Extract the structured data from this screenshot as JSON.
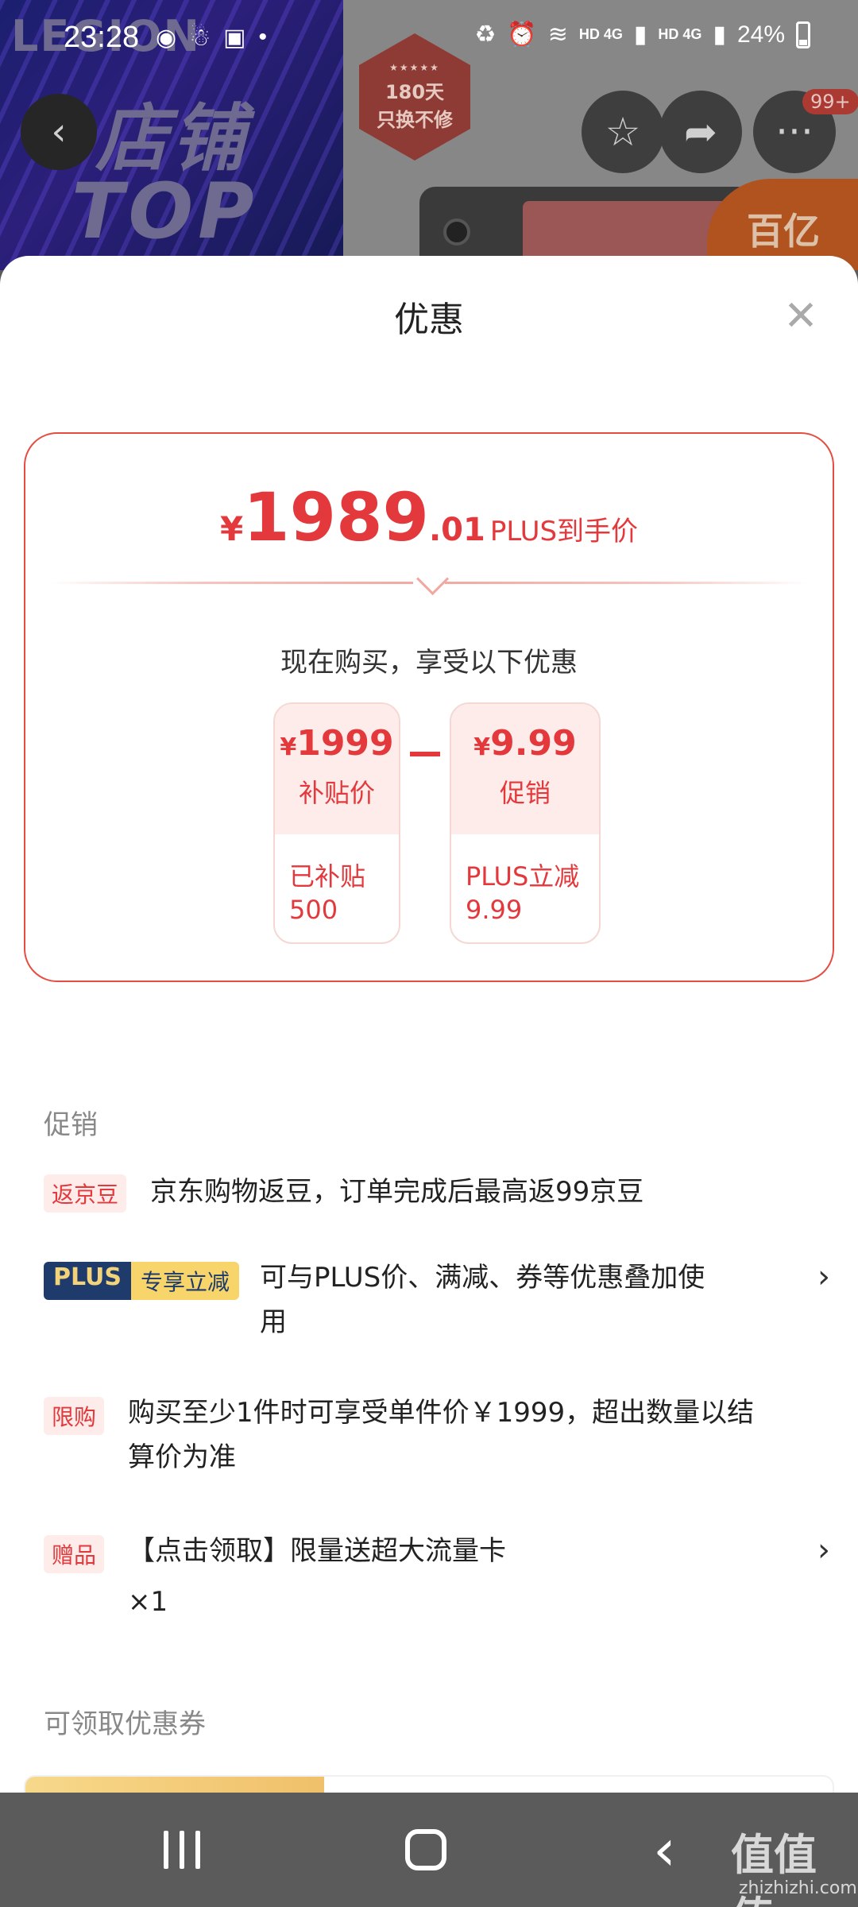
{
  "status_bar": {
    "time": "23:28",
    "network_left": "HD 4G",
    "network_right": "HD 4G",
    "battery": "24%"
  },
  "background": {
    "banner_logo": "LEGION",
    "banner_line1": "店铺",
    "banner_line2": "TOP",
    "badge_line1": "180天",
    "badge_line2": "只换不修",
    "orange_tag": "百亿",
    "more_badge": "99+"
  },
  "sheet": {
    "title": "优惠",
    "price_card": {
      "currency": "¥",
      "price_int": "1989",
      "price_dec": ".01",
      "price_tag": "PLUS到手价",
      "enjoy_text": "现在购买，享受以下优惠",
      "box1": {
        "currency": "¥",
        "amount": "1999",
        "label": "补贴价",
        "detail1": "已补贴",
        "detail2": "500"
      },
      "box2": {
        "currency": "¥",
        "amount": "9.99",
        "label": "促销",
        "detail1": "PLUS立减",
        "detail2": "9.99"
      }
    },
    "promo_section": {
      "title": "促销",
      "items": [
        {
          "tag": "返京豆",
          "text": "京东购物返豆，订单完成后最高返99京豆"
        },
        {
          "tag_plus": "PLUS",
          "tag_extra": "专享立减",
          "text1": "可与PLUS价、满减、券等优惠叠加使",
          "text2": "用"
        },
        {
          "tag": "限购",
          "text1": "购买至少1件时可享受单件价￥1999，超出数量以结",
          "text2": "算价为准"
        },
        {
          "tag": "赠品",
          "text1": "【点击领取】限量送超大流量卡",
          "text2": "×1"
        }
      ]
    },
    "coupon_section": {
      "title": "可领取优惠券"
    }
  },
  "watermark": {
    "text": "值值值",
    "url": "zhizhizhi.com"
  }
}
